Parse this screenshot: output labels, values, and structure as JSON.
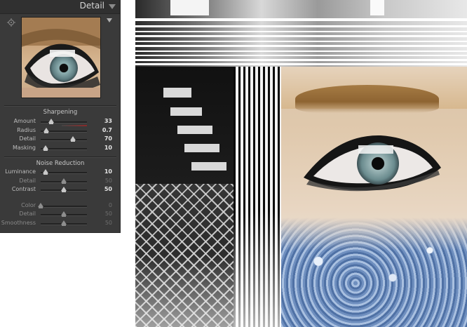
{
  "panel": {
    "title": "Detail",
    "sharpening": {
      "title": "Sharpening",
      "sliders": [
        {
          "label": "Amount",
          "value": "33",
          "fraction": 0.22,
          "dim": false
        },
        {
          "label": "Radius",
          "value": "0.7",
          "fraction": 0.12,
          "dim": false
        },
        {
          "label": "Detail",
          "value": "70",
          "fraction": 0.7,
          "dim": false
        },
        {
          "label": "Masking",
          "value": "10",
          "fraction": 0.1,
          "dim": false
        }
      ]
    },
    "noise_reduction": {
      "title": "Noise Reduction",
      "sliders": [
        {
          "label": "Luminance",
          "value": "10",
          "fraction": 0.1,
          "dim": false
        },
        {
          "label": "Detail",
          "value": "50",
          "fraction": 0.5,
          "dim": true
        },
        {
          "label": "Contrast",
          "value": "50",
          "fraction": 0.5,
          "dim": false
        },
        {
          "label": "Color",
          "value": "0",
          "fraction": 0.0,
          "dim": true
        },
        {
          "label": "Detail",
          "value": "50",
          "fraction": 0.5,
          "dim": true
        },
        {
          "label": "Smoothness",
          "value": "50",
          "fraction": 0.5,
          "dim": true
        }
      ]
    }
  },
  "colors": {
    "panel_bg": "#3a3a3a",
    "header_bg": "#303030",
    "amount_accent": "#8a2a2a",
    "iris": "#6f8f92",
    "ice": "#6d8dbd"
  },
  "icons": [
    "target-adjust-icon",
    "collapse-triangle-icon",
    "preview-menu-icon"
  ]
}
